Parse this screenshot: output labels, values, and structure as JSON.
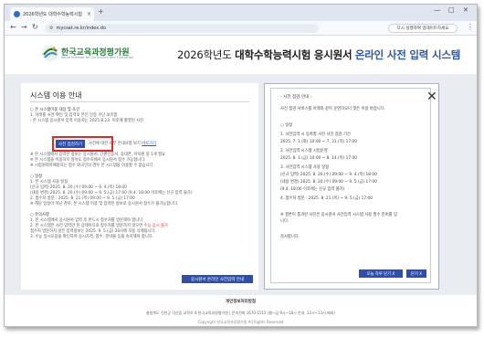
{
  "browser": {
    "tab_title": "2026학년도 대학수학능력시험",
    "tab_close": "×",
    "new_tab": "+",
    "window_controls": [
      "—",
      "□",
      "✕"
    ],
    "nav_icons": [
      "←",
      "→",
      "↻"
    ],
    "url": "mycsat.re.kr/index.do",
    "relaunch_label": "다시 실행하여 업데이트하세요",
    "menu": "⋮"
  },
  "header": {
    "logo_name": "한국교육과정평가원",
    "logo_sub": "Korea Institute for Curriculum and Evaluation",
    "title_year": "2026학년도",
    "title_main": "대학수학능력시험 응시원서",
    "title_accent": "온라인 사전 입력 시스템"
  },
  "main_panel": {
    "title": "시스템 이용 안내",
    "notice_lines": [
      "○ 본 시스템이용 대상 및 조건",
      "1. 아래를 사전 확인 및 입력로 본인 인증 수단 보유함",
      "- 본 시스템 응시원서 입력 이용자는 2025.8.23. 이후에 촬영된 사진",
      "                                   사전에 대한 세부 안내사항 보기",
      "※ 본 시스템에서 입력한 정보는 응시원서, 간편인증서, 휴대폰, 아이핀 중 1개 필요",
      "※ 본 시스템을 이용하지 않아도 접수처에서 응시원서 접수 가능합니다.",
      "※ 시험원회복예정자는 접수 외국인의 경우 본 시스템을 이용할 수 없습니다.",
      "○ 일정",
      "1. 본 시스템 사용 일정",
      "(신규 입력) 2025. 8. 20.(수) 09:00 ~ 9. 4.(목) 18:00",
      "(내용 변경) 2025. 8. 20.(수) 09:00 ~ 9. 5.(금) 17:00 (9.4. 18:00 이후에는 신규 입력 불가)",
      "2. 접수처 방문 : 2025. 8. 21.(목) 09:00 ~ 9. 5.(금) 17:00",
      "※ 해당 일정이 아닌 경우, 본 시스템 이용 및 입력된 정보로 응시원서 접수가 불가능합니다.",
      "○ 유의사항",
      "1. 본 시스템에서 응시원서 입력 후 반드시 접수처를 방문해야 합니다.",
      "2. 본 시스템은 사전 입력만 된 상태이므로 접수처를 방문하지 않으면",
      "   접수처 방문하지 않은 입력정보는 2025. 9. 5.(금) 20시에 자동 삭제됩니다.",
      "3. 수능 일시오답을 확인하여 응시자격, 접수, 준비물 등을 숙지해야 합니다."
    ],
    "notice_red_suffix": "수능 응시 불가",
    "notice_link": "바로가기",
    "pre_check_label": "사전 점검하기",
    "online_button": "응시원서 온라인 사전입력 안내"
  },
  "popup": {
    "title": "- 사전 점검 안내 -",
    "close": "✕",
    "lines": [
      "사전 점검 서비스를 아래와 같이 운영하오니 많은 이용 바랍니다.",
      "",
      "○ 일정",
      "1. 사전입력 시 등록할 사진 사전 점검 기간",
      "   2025. 7. 1.(화) 10:00 ~ 7. 31.(목) 17:00",
      "2. 사전입력 시스템 시범운영",
      "   2025. 8. 1.(금) 10:00 ~ 8. 14.(목) 17:00",
      "3. 사전입력 시스템 사용 일정",
      "   (신규 입력) 2025. 8. 20.(수) 09:00 ~ 9. 4.(목) 18:00",
      "   (내용 변경) 2025. 8. 20.(수) 09:00 ~ 9. 5.(금) 17:00",
      "                   (9.4. 18:00 이후에는 신규 입력 불가)",
      "4. 접수처 방문 : 2025. 8. 21.(목) ~ 9. 5.(금) 17:00",
      "",
      "※ 결론이 통과된 사진은 응시원서 사전입력 시스템 사용 필수 준비를 입",
      "니다.",
      "",
      "감사합니다."
    ],
    "today_close": "오늘 하루 닫기 X",
    "close_btn": "닫기 X"
  },
  "footer": {
    "link": "개인정보처리방침",
    "address": "충청북도 진천군 덕산읍 교학로 8 한국교육과정평가원  |  문의전화 1670-1515 (평~금 9시~18시 안내, 12시~13시 제외)",
    "copyright": "Copyright 한국교육과정평가원 All Rights Reserved"
  },
  "colors": {
    "accent": "#2c4fae",
    "highlight": "#e02a2a",
    "brand_green": "#2a7a3c"
  }
}
